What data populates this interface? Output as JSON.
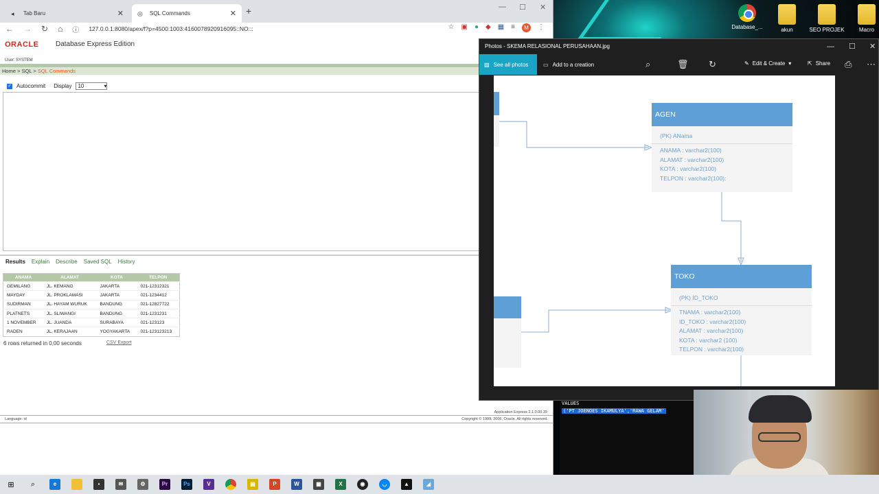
{
  "browser": {
    "tabs": [
      {
        "label": "Tab Baru"
      },
      {
        "label": "SQL Commands"
      }
    ],
    "url": "127.0.0.1:8080/apex/f?p=4500:1003:4160078920916095::NO:::"
  },
  "apex": {
    "logo": "ORACLE",
    "title": "Database Express Edition",
    "user": "User: SYSTEM",
    "breadcrumb": {
      "home": "Home",
      "sql": "SQL",
      "current": "SQL Commands"
    },
    "autocommit_label": "Autocommit",
    "display_label": "Display",
    "display_value": "10",
    "tabs": [
      "Results",
      "Explain",
      "Describe",
      "Saved SQL",
      "History"
    ],
    "results": {
      "columns": [
        "ANAMA",
        "ALAMAT",
        "KOTA",
        "TELPON"
      ],
      "rows": [
        [
          "GEMILANG",
          "JL. KEMANG",
          "JAKARTA",
          "021-12312321"
        ],
        [
          "MAYDAY",
          "JL. PROKLAMASI",
          "JAKARTA",
          "021-1234412"
        ],
        [
          "SUDIRMAN",
          "JL. HAYAM WURUK",
          "BANDUNG",
          "021-12827722"
        ],
        [
          "PLATNETS",
          "JL. SLIWANGI",
          "BANDUNG",
          "021-1231231"
        ],
        [
          "1 NOVEMBER",
          "JL. JUANDA",
          "SURABAYA",
          "021-123123"
        ],
        [
          "RADEN",
          "JL. KERAJAAN",
          "YOGYAKARTA",
          "021-123123213"
        ]
      ]
    },
    "rows_info": "6 rows returned in 0,00 seconds",
    "csv_export": "CSV Export",
    "language": "Language: id",
    "app_version": "Application Express 2.1.0.00.39",
    "copyright": "Copyright © 1999, 2006, Oracle. All rights reserved."
  },
  "photos": {
    "title": "Photos - SKEMA RELASIONAL PERUSAHAAN.jpg",
    "see_all": "See all photos",
    "add_creation": "Add to a creation",
    "edit_create": "Edit & Create",
    "share": "Share",
    "entities": [
      {
        "name": "AGEN",
        "pk": "(PK) ANama",
        "attrs": [
          "ANAMA : varchar2(100)",
          "ALAMAT : varchar2(100)",
          "KOTA : varchar2(100)",
          "TELPON : varchar2(100):"
        ]
      },
      {
        "name": "TOKO",
        "pk": "(PK) ID_TOKO",
        "attrs": [
          "TNAMA : varchar2(100)",
          "ID_TOKO : varchar2(100)",
          "ALAMAT : varchar2(100)",
          "KOTA : varchar2 (100)",
          "TELPON : varchar2(100)"
        ]
      }
    ]
  },
  "cmd": {
    "line1": "VALUES",
    "line2": "('PT JOENOES IKAMULYA','RAWA GELAM'"
  },
  "desktop_icons": [
    {
      "label": "Database_..."
    },
    {
      "label": "akun"
    },
    {
      "label": "SEO PROJEK"
    },
    {
      "label": "Macro"
    }
  ],
  "taskbar_icons": [
    "windows-start-icon",
    "search-icon",
    "edge-icon",
    "file-explorer-icon",
    "store-icon",
    "mail-icon",
    "settings-icon",
    "premiere-icon",
    "photoshop-icon",
    "visual-studio-icon",
    "chrome-icon",
    "notepad-icon",
    "powerpoint-icon",
    "word-icon",
    "calculator-icon",
    "excel-icon",
    "obs-icon",
    "messenger-icon",
    "photos-icon",
    "sql-icon"
  ]
}
